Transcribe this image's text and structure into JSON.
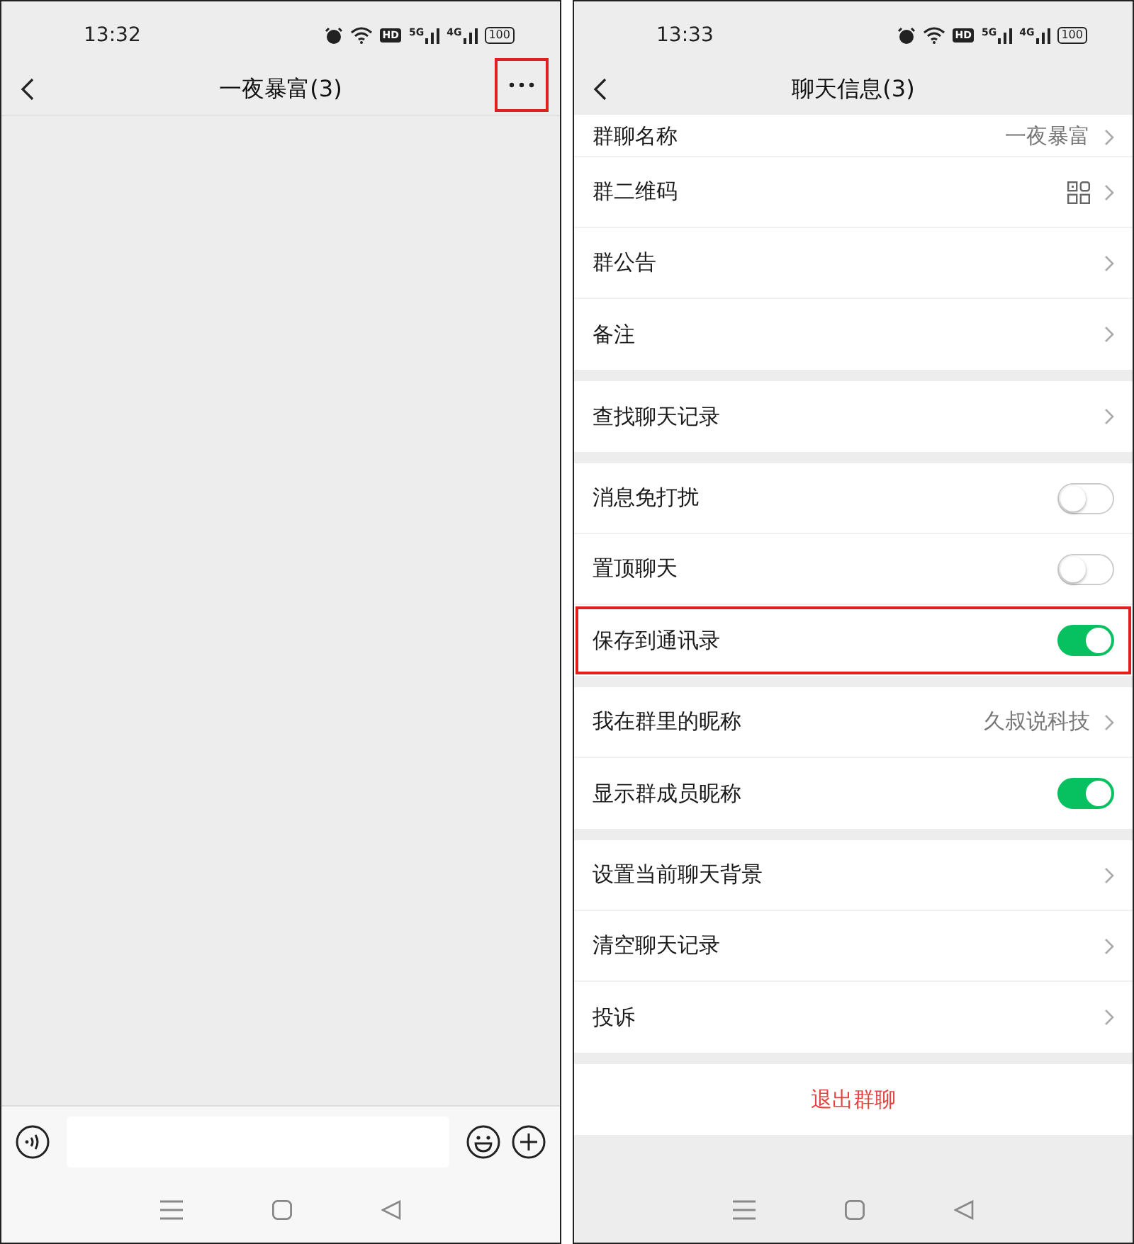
{
  "chat_screen": {
    "status_bar": {
      "time": "13:32",
      "hd": "HD",
      "net1": "5G",
      "net2": "4G",
      "battery": "100"
    },
    "header": {
      "title": "一夜暴富(3)",
      "more_highlighted": true
    },
    "input_bar": {
      "placeholder_visible": false
    }
  },
  "info_screen": {
    "status_bar": {
      "time": "13:33",
      "hd": "HD",
      "net1": "5G",
      "net2": "4G",
      "battery": "100"
    },
    "header": {
      "title": "聊天信息(3)"
    },
    "sections": [
      {
        "rows": [
          {
            "kind": "nav",
            "label": "群聊名称",
            "value": "一夜暴富",
            "cut": true
          },
          {
            "kind": "qr",
            "label": "群二维码"
          },
          {
            "kind": "nav",
            "label": "群公告"
          },
          {
            "kind": "nav",
            "label": "备注"
          }
        ]
      },
      {
        "rows": [
          {
            "kind": "nav",
            "label": "查找聊天记录"
          }
        ]
      },
      {
        "rows": [
          {
            "kind": "toggle",
            "label": "消息免打扰",
            "on": false,
            "highlighted": false
          },
          {
            "kind": "toggle",
            "label": "置顶聊天",
            "on": false,
            "highlighted": false
          },
          {
            "kind": "toggle",
            "label": "保存到通讯录",
            "on": true,
            "highlighted": true
          }
        ]
      },
      {
        "rows": [
          {
            "kind": "nav",
            "label": "我在群里的昵称",
            "value": "久叔说科技"
          },
          {
            "kind": "toggle",
            "label": "显示群成员昵称",
            "on": true,
            "highlighted": false
          }
        ]
      },
      {
        "rows": [
          {
            "kind": "nav",
            "label": "设置当前聊天背景"
          },
          {
            "kind": "nav",
            "label": "清空聊天记录"
          },
          {
            "kind": "nav",
            "label": "投诉"
          }
        ]
      }
    ],
    "exit_button": "退出群聊"
  }
}
